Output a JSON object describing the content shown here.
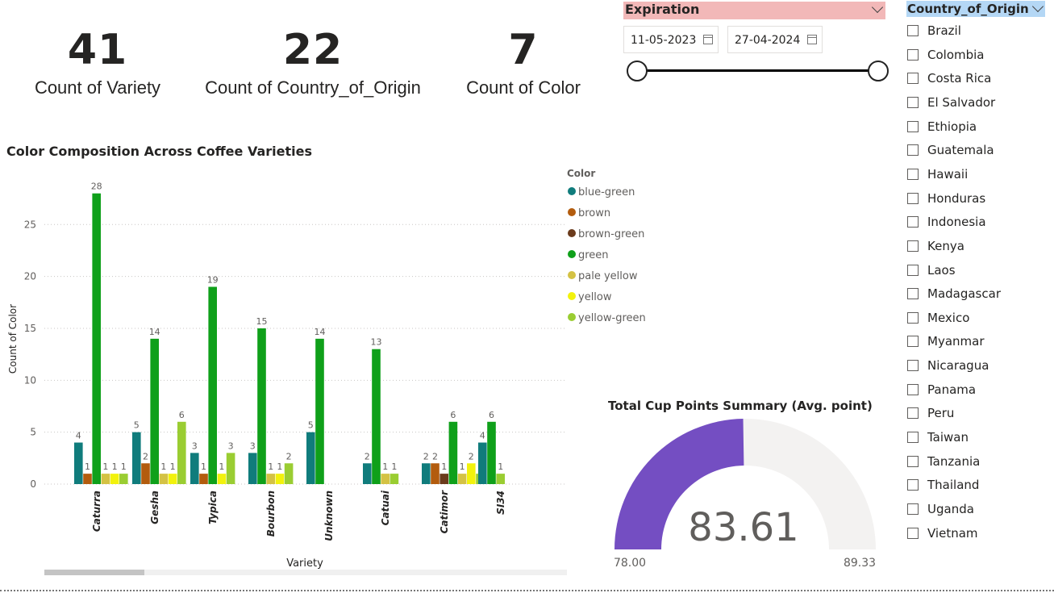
{
  "kpis": [
    {
      "value": "41",
      "label": "Count of Variety"
    },
    {
      "value": "22",
      "label": "Count of Country_of_Origin"
    },
    {
      "value": "7",
      "label": "Count of Color"
    }
  ],
  "expiration_slicer": {
    "title": "Expiration",
    "start_date": "11-05-2023",
    "end_date": "27-04-2024",
    "header_color": "#f2b8b8"
  },
  "country_slicer": {
    "title": "Country_of_Origin",
    "header_color": "#b4d7f5",
    "items": [
      "Brazil",
      "Colombia",
      "Costa Rica",
      "El Salvador",
      "Ethiopia",
      "Guatemala",
      "Hawaii",
      "Honduras",
      "Indonesia",
      "Kenya",
      "Laos",
      "Madagascar",
      "Mexico",
      "Myanmar",
      "Nicaragua",
      "Panama",
      "Peru",
      "Taiwan",
      "Tanzania",
      "Thailand",
      "Uganda",
      "Vietnam"
    ]
  },
  "chart_data": {
    "type": "bar",
    "title": "Color Composition Across Coffee Varieties",
    "xlabel": "Variety",
    "ylabel": "Count of Color",
    "ylim": [
      0,
      28
    ],
    "yticks": [
      0,
      5,
      10,
      15,
      20,
      25
    ],
    "grid": true,
    "legend_title": "Color",
    "legend_position": "right",
    "categories": [
      "Caturra",
      "Gesha",
      "Typica",
      "Bourbon",
      "Unknown",
      "Catuai",
      "Catimor",
      "SI34"
    ],
    "series": [
      {
        "name": "blue-green",
        "color": "#107c7c",
        "values": [
          4,
          5,
          3,
          3,
          5,
          2,
          2,
          4
        ]
      },
      {
        "name": "brown",
        "color": "#b35c0e",
        "values": [
          1,
          2,
          1,
          null,
          null,
          null,
          2,
          null
        ]
      },
      {
        "name": "brown-green",
        "color": "#6b3b1c",
        "values": [
          null,
          null,
          null,
          null,
          null,
          null,
          1,
          null
        ]
      },
      {
        "name": "green",
        "color": "#0fa01a",
        "values": [
          28,
          14,
          19,
          15,
          14,
          13,
          6,
          6
        ]
      },
      {
        "name": "pale yellow",
        "color": "#d4c244",
        "values": [
          1,
          1,
          null,
          1,
          null,
          1,
          1,
          null
        ]
      },
      {
        "name": "yellow",
        "color": "#f2f20c",
        "values": [
          1,
          1,
          1,
          1,
          null,
          null,
          2,
          null
        ]
      },
      {
        "name": "yellow-green",
        "color": "#9acd32",
        "values": [
          1,
          6,
          3,
          2,
          null,
          1,
          1,
          1
        ]
      }
    ]
  },
  "gauge": {
    "title": "Total Cup Points Summary (Avg. point)",
    "value": "83.61",
    "value_num": 83.61,
    "min": "78.00",
    "min_num": 78.0,
    "max": "89.33",
    "max_num": 89.33,
    "fill_color": "#744ec2",
    "track_color": "#f3f2f1"
  }
}
